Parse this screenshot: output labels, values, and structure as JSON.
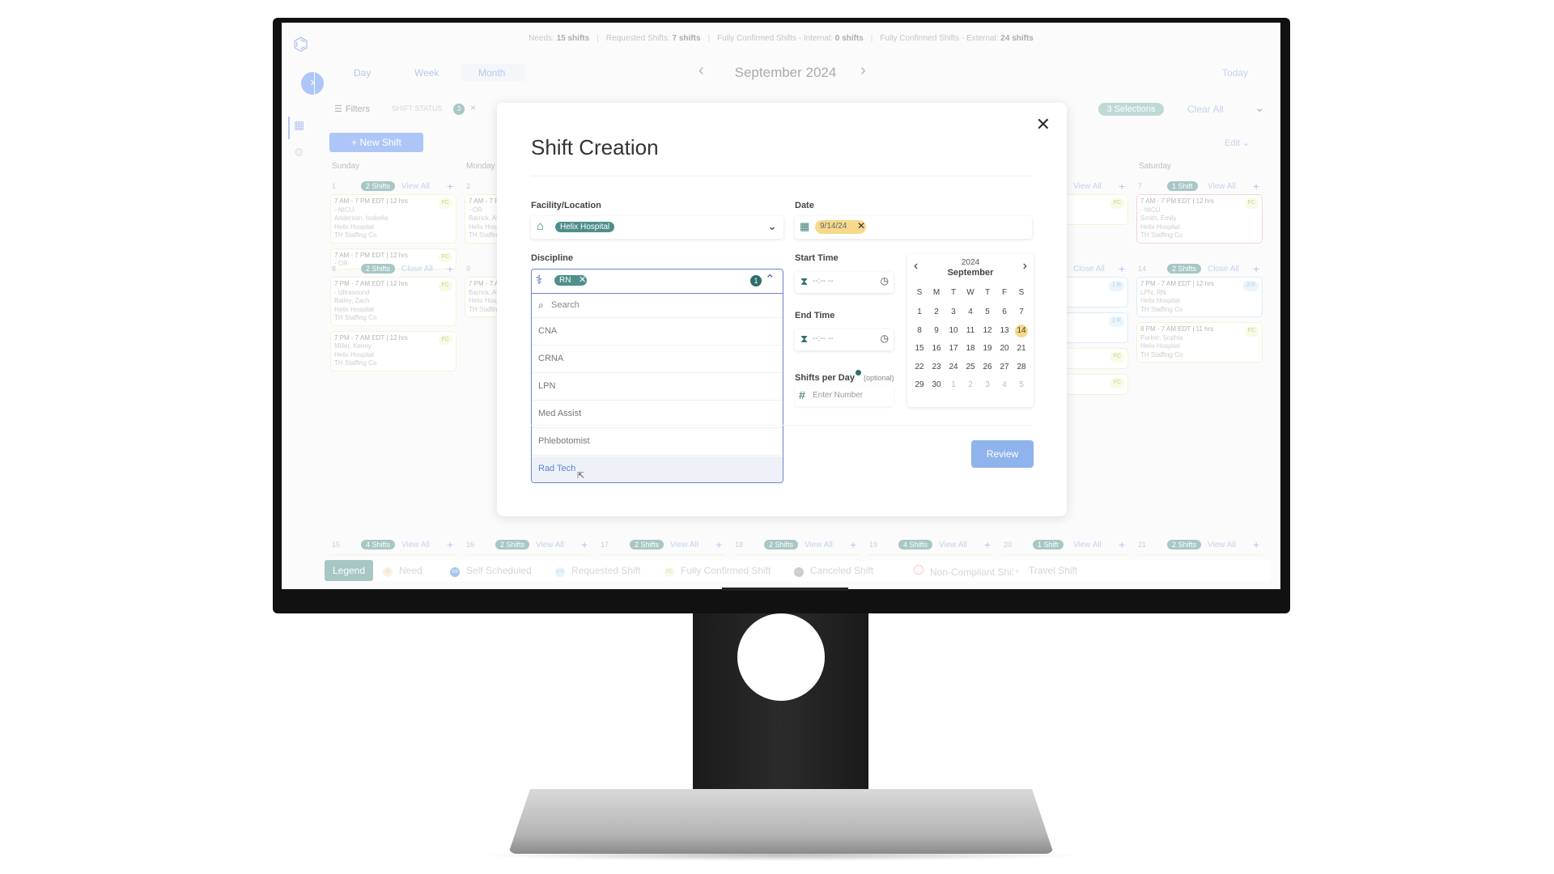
{
  "stats": [
    {
      "label": "Needs:",
      "value": "15 shifts"
    },
    {
      "label": "Requested Shifts:",
      "value": "7 shifts"
    },
    {
      "label": "Fully Confirmed Shifts - Internal:",
      "value": "0 shifts"
    },
    {
      "label": "Fully Confirmed Shifts - External:",
      "value": "24 shifts"
    }
  ],
  "view_tabs": {
    "day": "Day",
    "week": "Week",
    "month": "Month",
    "active": "Month"
  },
  "period_title": "September 2024",
  "today": "Today",
  "filters": {
    "label": "Filters",
    "shift_status": "SHIFT STATUS",
    "count": "3",
    "selections": "3 Selections",
    "clear_all": "Clear All"
  },
  "new_shift": "+ New Shift",
  "edit": "Edit",
  "day_headers": {
    "sunday": "Sunday",
    "monday": "Monday",
    "saturday": "Saturday"
  },
  "calendar": [
    {
      "col": 0,
      "row": 0,
      "date": "1",
      "chip": "2 Shifts",
      "action": "View All",
      "cards": [
        {
          "time": "7 AM - 7 PM EDT",
          "hrs": "| 12 hrs",
          "lines": [
            "- NICU",
            "Anderson, Isabella",
            "Helix Hospital",
            "TH Staffing Co"
          ],
          "badge": "FC",
          "kind": "green"
        },
        {
          "time": "7 AM - 7 PM EDT",
          "hrs": "| 12 hrs",
          "lines": [
            "- OR"
          ],
          "badge": "FC",
          "kind": "green",
          "short": true
        }
      ]
    },
    {
      "col": 1,
      "row": 0,
      "date": "2",
      "cards": [
        {
          "time": "7 AM - 7 PM",
          "hrs": "",
          "lines": [
            "- OR",
            "Barrick, Al",
            "Helix Hosp",
            "TH Staffing"
          ],
          "kind": "green"
        }
      ]
    },
    {
      "col": 5,
      "row": 0,
      "chip": "",
      "action": "View All",
      "cards": [
        {
          "time": "",
          "hrs": "rs",
          "lines": [],
          "badge": "FC",
          "kind": "green"
        }
      ]
    },
    {
      "col": 6,
      "row": 0,
      "date": "7",
      "chip": "1 Shift",
      "action": "View All",
      "cards": [
        {
          "time": "7 AM - 7 PM EDT",
          "hrs": "| 12 hrs",
          "lines": [
            "- NICU",
            "Smith, Emily",
            "Helix Hospital",
            "TH Staffing Co"
          ],
          "badge": "FC",
          "kind": "red"
        }
      ]
    },
    {
      "col": 0,
      "row": 1,
      "date": "8",
      "chip": "2 Shifts",
      "action": "Close All",
      "cards": [
        {
          "time": "7 PM - 7 AM EDT",
          "hrs": "| 12 hrs",
          "lines": [
            "- Ultrasound",
            "Bailey, Zach",
            "Helix Hospital",
            "TH Staffing Co"
          ],
          "badge": "FC",
          "kind": "green"
        },
        {
          "time": "7 PM - 7 AM EDT",
          "hrs": "| 12 hrs",
          "lines": [
            "Miller, Kenny",
            "Helix Hospital",
            "TH Staffing Co"
          ],
          "badge": "FC",
          "kind": "green"
        }
      ]
    },
    {
      "col": 1,
      "row": 1,
      "date": "9",
      "cards": [
        {
          "time": "7 PM - 7 A",
          "hrs": "",
          "lines": [
            "Barrick, Al",
            "Helix Hosp",
            "TH Staffing"
          ],
          "kind": "green"
        }
      ]
    },
    {
      "col": 5,
      "row": 1,
      "action": "Close All",
      "cards": [
        {
          "time": "",
          "hrs": "rs",
          "lines": [],
          "badge": "1 R",
          "kind": "blue"
        },
        {
          "time": "",
          "hrs": "rs",
          "lines": [],
          "badge": "2 R",
          "kind": "blue"
        },
        {
          "time": "",
          "hrs": "rs",
          "lines": [],
          "badge": "FC",
          "kind": "green",
          "short": true
        },
        {
          "time": "",
          "hrs": "",
          "lines": [],
          "badge": "FC",
          "kind": "green",
          "short": true
        }
      ]
    },
    {
      "col": 6,
      "row": 1,
      "date": "14",
      "chip": "2 Shifts",
      "action": "Close All",
      "cards": [
        {
          "time": "7 PM - 7 AM EDT",
          "hrs": "| 12 hrs",
          "lines": [
            "LPN, RN",
            "Helix Hospital",
            "TH Staffing Co"
          ],
          "badge": "3 R",
          "kind": "blue"
        },
        {
          "time": "8 PM - 7 AM EDT",
          "hrs": "| 11 hrs",
          "lines": [
            "Parker, Sophia",
            "Helix Hospital",
            "TH Staffing Co"
          ],
          "badge": "FC",
          "kind": "green"
        }
      ]
    },
    {
      "col": 0,
      "row": 2,
      "date": "15",
      "chip": "4 Shifts",
      "action": "View All",
      "cards": []
    },
    {
      "col": 1,
      "row": 2,
      "date": "16",
      "chip": "2 Shifts",
      "action": "View All",
      "cards": []
    },
    {
      "col": 2,
      "row": 2,
      "date": "17",
      "chip": "2 Shifts",
      "action": "View All",
      "cards": []
    },
    {
      "col": 3,
      "row": 2,
      "date": "18",
      "chip": "2 Shifts",
      "action": "View All",
      "cards": []
    },
    {
      "col": 4,
      "row": 2,
      "date": "19",
      "chip": "4 Shifts",
      "action": "View All",
      "cards": []
    },
    {
      "col": 5,
      "row": 2,
      "date": "20",
      "chip": "1 Shift",
      "action": "View All",
      "cards": []
    },
    {
      "col": 6,
      "row": 2,
      "date": "21",
      "chip": "2 Shifts",
      "action": "View All",
      "cards": []
    }
  ],
  "legend": {
    "title": "Legend",
    "items": [
      {
        "label": "Need",
        "mark": "N",
        "color": "#f5e6b8"
      },
      {
        "label": "Self Scheduled",
        "mark": "SS",
        "color": "#4a8fd6"
      },
      {
        "label": "Requested Shift",
        "mark": "# R",
        "color": "#cfe6f7"
      },
      {
        "label": "Fully Confirmed Shift",
        "mark": "FC",
        "color": "#eef6c9"
      },
      {
        "label": "Canceled Shift",
        "mark": "C",
        "color": "#999"
      },
      {
        "label": "Non-Compliant Shift",
        "mark": "",
        "color": "#f08a8f"
      },
      {
        "label": "Travel Shift",
        "mark": "✈",
        "color": "#fff"
      }
    ]
  },
  "modal": {
    "title": "Shift Creation",
    "facility_label": "Facility/Location",
    "facility_value": "Helix Hospital",
    "date_label": "Date",
    "date_value": "9/14/24",
    "discipline_label": "Discipline",
    "discipline_value": "RN",
    "discipline_count": "1",
    "search_placeholder": "Search",
    "options": [
      "CNA",
      "CRNA",
      "LPN",
      "Med Assist",
      "Phlebotomist",
      "Rad Tech"
    ],
    "highlighted_option": "Rad Tech",
    "start_label": "Start Time",
    "start_value": "--:-- --",
    "end_label": "End Time",
    "end_value": "--:-- --",
    "shifts_label": "Shifts per Day",
    "shifts_optional": "(optional)",
    "shifts_placeholder": "Enter Number",
    "review": "Review",
    "picker": {
      "year": "2024",
      "month": "September",
      "weekdays": [
        "S",
        "M",
        "T",
        "W",
        "T",
        "F",
        "S"
      ],
      "weeks": [
        [
          "1",
          "2",
          "3",
          "4",
          "5",
          "6",
          "7"
        ],
        [
          "8",
          "9",
          "10",
          "11",
          "12",
          "13",
          "14"
        ],
        [
          "15",
          "16",
          "17",
          "18",
          "19",
          "20",
          "21"
        ],
        [
          "22",
          "23",
          "24",
          "25",
          "26",
          "27",
          "28"
        ],
        [
          "29",
          "30",
          "1",
          "2",
          "3",
          "4",
          "5"
        ]
      ],
      "selected": "14"
    }
  },
  "colors": {
    "teal": "#4f8f8b",
    "blue": "#5b8def",
    "selected_date": "#f7d98b",
    "review": "#8fb3ec"
  }
}
